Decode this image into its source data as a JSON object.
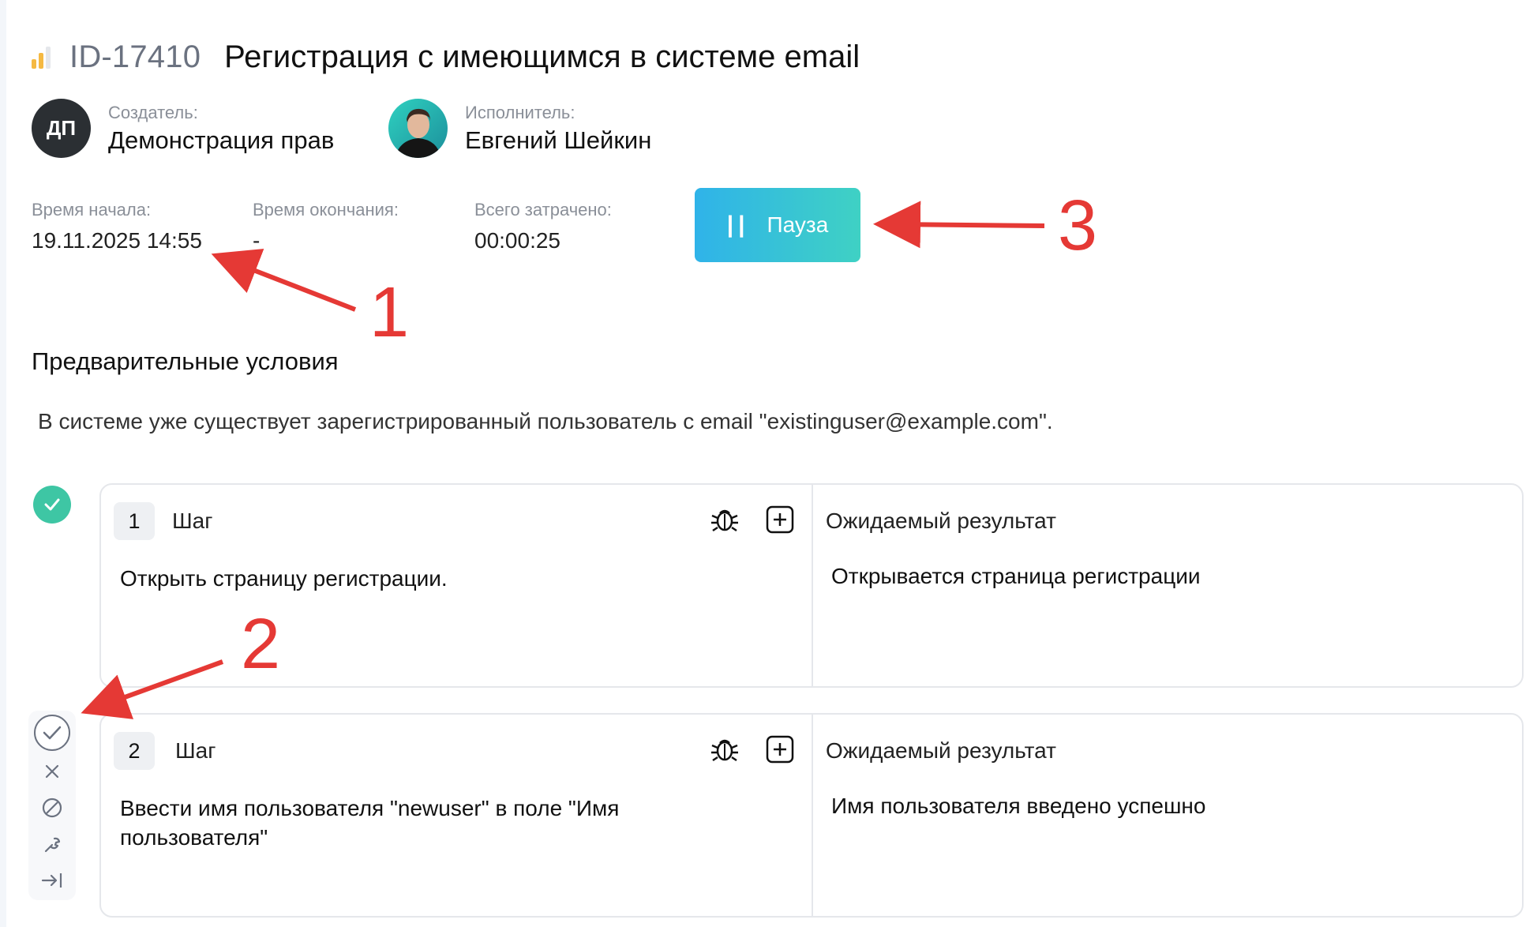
{
  "header": {
    "task_id": "ID-17410",
    "title": "Регистрация с имеющимся в системе email",
    "priority_icon": "priority-bars-icon",
    "priority_color": "#f5b942"
  },
  "creator": {
    "label": "Создатель:",
    "name": "Демонстрация прав",
    "initials": "ДП"
  },
  "assignee": {
    "label": "Исполнитель:",
    "name": "Евгений Шейкин"
  },
  "meta": {
    "start_label": "Время начала:",
    "start_value": "19.11.2025 14:55",
    "end_label": "Время окончания:",
    "end_value": "-",
    "total_label": "Всего затрачено:",
    "total_value": "00:00:25"
  },
  "pause_button": {
    "label": "Пауза",
    "icon": "pause-icon"
  },
  "preconditions": {
    "title": "Предварительные условия",
    "text": "В системе уже существует зарегистрированный пользователь с email \"existinguser@example.com\"."
  },
  "steps": [
    {
      "number": "1",
      "step_label": "Шаг",
      "action": "Открыть страницу регистрации.",
      "expected_label": "Ожидаемый результат",
      "expected": "Открывается страница регистрации",
      "status": "passed"
    },
    {
      "number": "2",
      "step_label": "Шаг",
      "action": "Ввести имя пользователя \"newuser\" в поле \"Имя пользователя\"",
      "expected_label": "Ожидаемый результат",
      "expected": "Имя пользователя введено успешно",
      "status": "pending"
    }
  ],
  "annotations": {
    "a1": "1",
    "a2": "2",
    "a3": "3",
    "color": "#e53935"
  },
  "colors": {
    "accent_start": "#2fb3e9",
    "accent_end": "#3fd1c4",
    "passed": "#3ec6a4"
  }
}
